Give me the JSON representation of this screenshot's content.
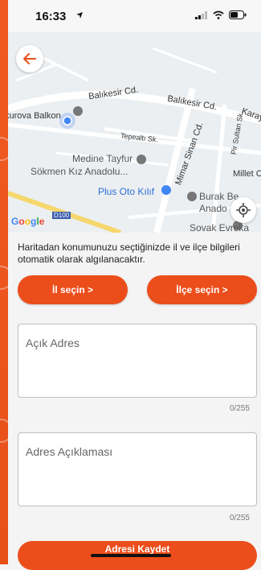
{
  "status_bar": {
    "time": "16:33"
  },
  "map": {
    "labels": {
      "balikesir_1": "Balıkesir Cd.",
      "balikesir_2": "Balıkesir Cd.",
      "kurova": "kurova Balkon",
      "tepealti": "Tepealtı Sk.",
      "mimar": "Mimar Sinan Cd.",
      "pir": "Pir Sultan Sk.",
      "karayel": "Karayel",
      "medine_1": "Medine Tayfur",
      "medine_2": "Sökmen Kız Anadolu...",
      "millet": "Millet C",
      "plus_oto": "Plus Oto Kılıf",
      "burak_1": "Burak Be",
      "burak_2": "Anado",
      "sovak": "Sovak Evreka",
      "d100": "D100",
      "google": "Google"
    }
  },
  "info_text": "Haritadan konumunuzu seçtiğinizde il ve ilçe bilgileri otomatik olarak algılanacaktır.",
  "buttons": {
    "il": "İl seçin >",
    "ilce": "İlçe seçin >",
    "save": "Adresi Kaydet"
  },
  "fields": {
    "open_address": {
      "placeholder": "Açık Adres",
      "counter": "0/255"
    },
    "address_desc": {
      "placeholder": "Adres Açıklaması",
      "counter": "0/255"
    }
  },
  "colors": {
    "accent": "#ec4e1b"
  }
}
